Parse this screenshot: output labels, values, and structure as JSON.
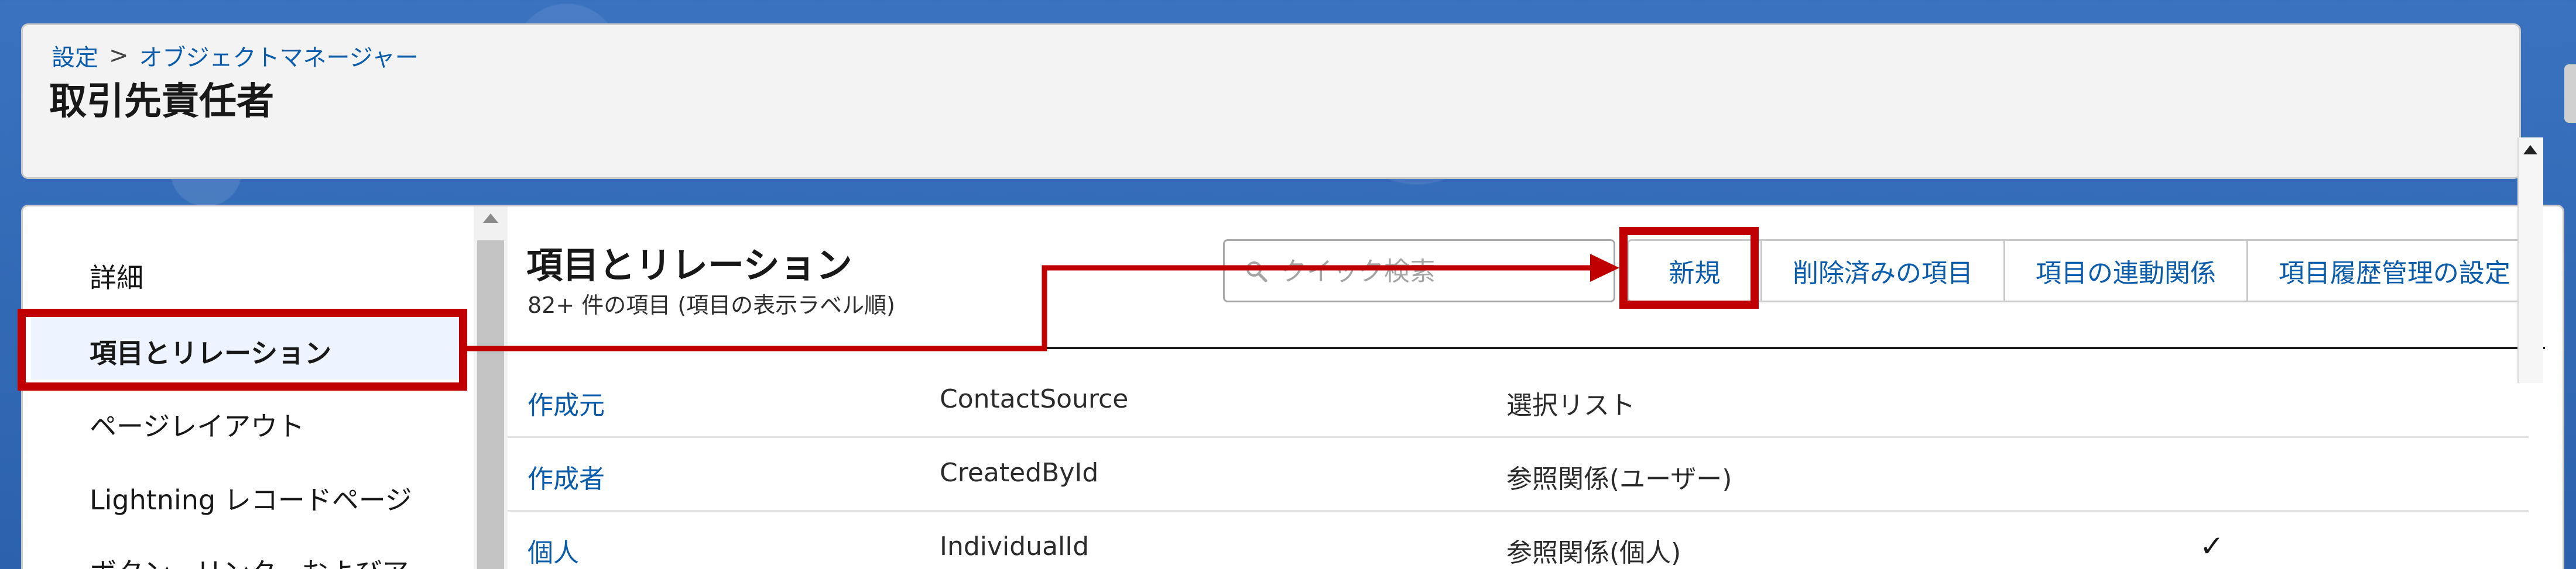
{
  "breadcrumb": {
    "root": "設定",
    "separator": ">",
    "current": "オブジェクトマネージャー"
  },
  "page": {
    "title": "取引先責任者"
  },
  "sidebar": {
    "items": [
      {
        "label": "詳細",
        "active": false
      },
      {
        "label": "項目とリレーション",
        "active": true
      },
      {
        "label": "ページレイアウト",
        "active": false
      },
      {
        "label": "Lightning レコードページ",
        "active": false
      },
      {
        "label": "ボタン、リンク、およびア",
        "active": false
      }
    ]
  },
  "content": {
    "title": "項目とリレーション",
    "subtitle": "82+ 件の項目 (項目の表示ラベル順)",
    "search_placeholder": "クイック検索",
    "search_icon": "search-icon"
  },
  "toolbar": {
    "new_label": "新規",
    "deleted_fields_label": "削除済みの項目",
    "field_dependencies_label": "項目の連動関係",
    "field_history_label": "項目履歴管理の設定"
  },
  "table": {
    "rows": [
      {
        "label": "作成元",
        "api_name": "ContactSource",
        "type": "選択リスト",
        "indexed": ""
      },
      {
        "label": "作成者",
        "api_name": "CreatedById",
        "type": "参照関係(ユーザー)",
        "indexed": ""
      },
      {
        "label": "個人",
        "api_name": "IndividualId",
        "type": "参照関係(個人)",
        "indexed": "✓"
      }
    ]
  },
  "colors": {
    "link": "#0b5cab",
    "highlight": "#c00000",
    "background": "#2f67b4"
  }
}
